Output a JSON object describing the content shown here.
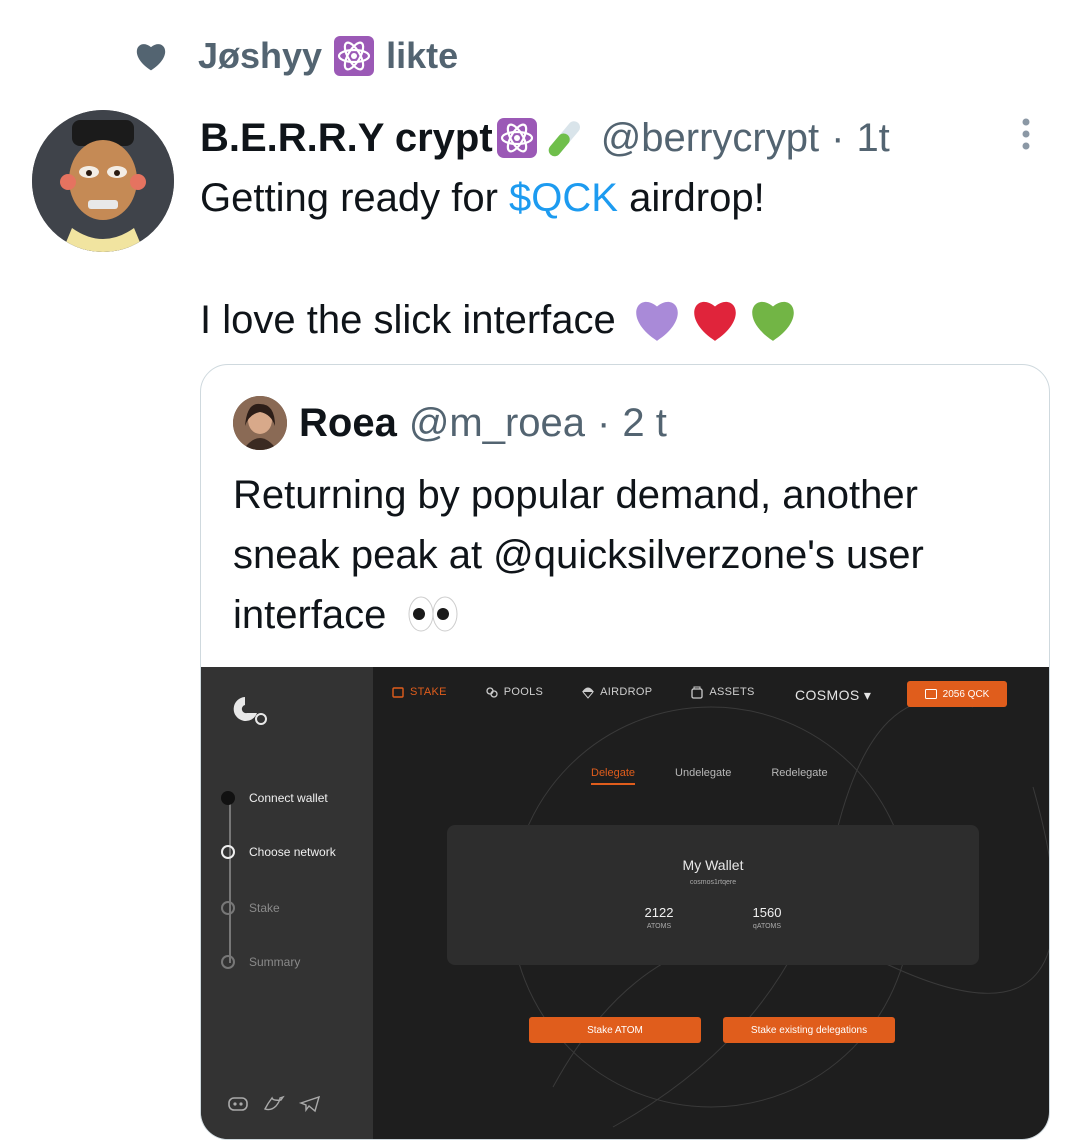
{
  "social_context": {
    "user": "Jøshyy",
    "action": "likte"
  },
  "tweet": {
    "author_name": "B.E.R.R.Y crypt",
    "handle": "@berrycrypt",
    "separator": "·",
    "time": "1t",
    "text_prefix": "Getting ready for ",
    "cashtag": "$QCK",
    "text_suffix": " airdrop!",
    "text_line2": "I love the slick interface"
  },
  "quote": {
    "author_name": "Roea",
    "handle": "@m_roea",
    "separator": "·",
    "time": "2 t",
    "text": "Returning by popular demand, another sneak peak at @quicksilverzone's user interface"
  },
  "app": {
    "nav": [
      "STAKE",
      "POOLS",
      "AIRDROP",
      "ASSETS"
    ],
    "network": "COSMOS ▾",
    "balance": "2056 QCK",
    "steps": [
      "Connect wallet",
      "Choose network",
      "Stake",
      "Summary"
    ],
    "tabs": [
      "Delegate",
      "Undelegate",
      "Redelegate"
    ],
    "wallet": {
      "title": "My Wallet",
      "address": "cosmos1rtqere",
      "stats": [
        {
          "value": "2122",
          "unit": "ATOMS"
        },
        {
          "value": "1560",
          "unit": "qATOMS"
        }
      ]
    },
    "actions": [
      "Stake ATOM",
      "Stake existing delegations"
    ],
    "accent_color": "#e05d1c"
  }
}
